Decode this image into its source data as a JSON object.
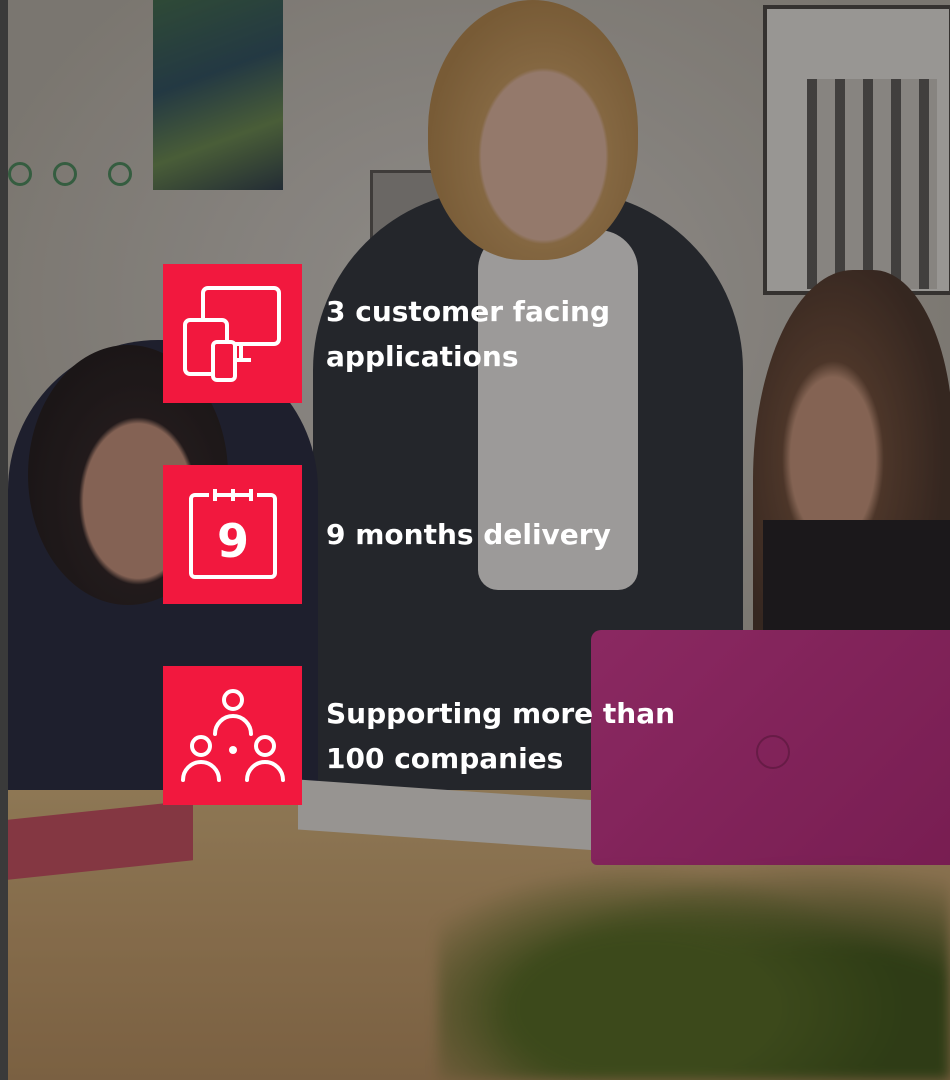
{
  "features": [
    {
      "icon": "devices-icon",
      "label": "3 customer facing applications"
    },
    {
      "icon": "calendar-icon",
      "label": "9 months delivery",
      "calendar_number": "9"
    },
    {
      "icon": "network-people-icon",
      "label": "Supporting more than 100 companies"
    }
  ],
  "colors": {
    "accent": "#f2183e",
    "text": "#ffffff"
  }
}
